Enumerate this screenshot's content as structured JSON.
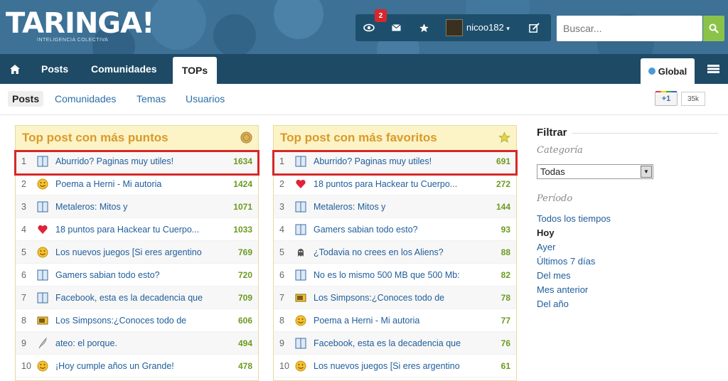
{
  "header": {
    "logo": "TARINGA!",
    "logo_sub": "INTELIGENCIA COLECTIVA",
    "notif_count": "2",
    "username": "nicoo182",
    "search_placeholder": "Buscar..."
  },
  "nav": {
    "items": [
      {
        "label": "Posts"
      },
      {
        "label": "Comunidades"
      },
      {
        "label": "TOPs"
      }
    ],
    "global_label": "Global"
  },
  "subnav": {
    "items": [
      {
        "label": "Posts",
        "active": true
      },
      {
        "label": "Comunidades"
      },
      {
        "label": "Temas"
      },
      {
        "label": "Usuarios"
      }
    ],
    "gplus_label": "+1",
    "gplus_count": "35k"
  },
  "panels": [
    {
      "title": "Top post con más puntos",
      "icon": "coin-icon",
      "rows": [
        {
          "n": "1",
          "icon": "book-icon",
          "title": "Aburrido? Paginas muy utiles!",
          "pts": "1634"
        },
        {
          "n": "2",
          "icon": "smiley-icon",
          "title": "Poema a Herni - Mi autoria",
          "pts": "1424"
        },
        {
          "n": "3",
          "icon": "book-icon",
          "title": "Metaleros: Mitos y",
          "pts": "1071"
        },
        {
          "n": "4",
          "icon": "heart-icon",
          "title": "18 puntos para Hackear tu Cuerpo...",
          "pts": "1033"
        },
        {
          "n": "5",
          "icon": "smiley-icon",
          "title": "Los nuevos juegos [Si eres argentino",
          "pts": "769"
        },
        {
          "n": "6",
          "icon": "book-icon",
          "title": "Gamers sabian todo esto?",
          "pts": "720"
        },
        {
          "n": "7",
          "icon": "book-icon",
          "title": "Facebook, esta es la decadencia que",
          "pts": "709"
        },
        {
          "n": "8",
          "icon": "tv-icon",
          "title": "Los Simpsons:¿Conoces todo de",
          "pts": "606"
        },
        {
          "n": "9",
          "icon": "quill-icon",
          "title": "ateo: el porque.",
          "pts": "494"
        },
        {
          "n": "10",
          "icon": "smiley-icon",
          "title": "¡Hoy cumple años un Grande!",
          "pts": "478"
        }
      ]
    },
    {
      "title": "Top post con más favoritos",
      "icon": "star-icon",
      "rows": [
        {
          "n": "1",
          "icon": "book-icon",
          "title": "Aburrido? Paginas muy utiles!",
          "pts": "691"
        },
        {
          "n": "2",
          "icon": "heart-icon",
          "title": "18 puntos para Hackear tu Cuerpo...",
          "pts": "272"
        },
        {
          "n": "3",
          "icon": "book-icon",
          "title": "Metaleros: Mitos y",
          "pts": "144"
        },
        {
          "n": "4",
          "icon": "book-icon",
          "title": "Gamers sabian todo esto?",
          "pts": "93"
        },
        {
          "n": "5",
          "icon": "alien-icon",
          "title": "¿Todavia no crees en los Aliens?",
          "pts": "88"
        },
        {
          "n": "6",
          "icon": "book-icon",
          "title": "No es lo mismo 500 MB que 500 Mb:",
          "pts": "82"
        },
        {
          "n": "7",
          "icon": "tv-icon",
          "title": "Los Simpsons:¿Conoces todo de",
          "pts": "78"
        },
        {
          "n": "8",
          "icon": "smiley-icon",
          "title": "Poema a Herni - Mi autoria",
          "pts": "77"
        },
        {
          "n": "9",
          "icon": "book-icon",
          "title": "Facebook, esta es la decadencia que",
          "pts": "76"
        },
        {
          "n": "10",
          "icon": "smiley-icon",
          "title": "Los nuevos juegos [Si eres argentino",
          "pts": "61"
        }
      ]
    }
  ],
  "filter": {
    "title": "Filtrar",
    "category_label": "Categoría",
    "category_value": "Todas",
    "period_label": "Período",
    "periods": [
      "Todos los tiempos",
      "Hoy",
      "Ayer",
      "Últimos 7 días",
      "Del mes",
      "Mes anterior",
      "Del año"
    ],
    "current_period": "Hoy"
  }
}
